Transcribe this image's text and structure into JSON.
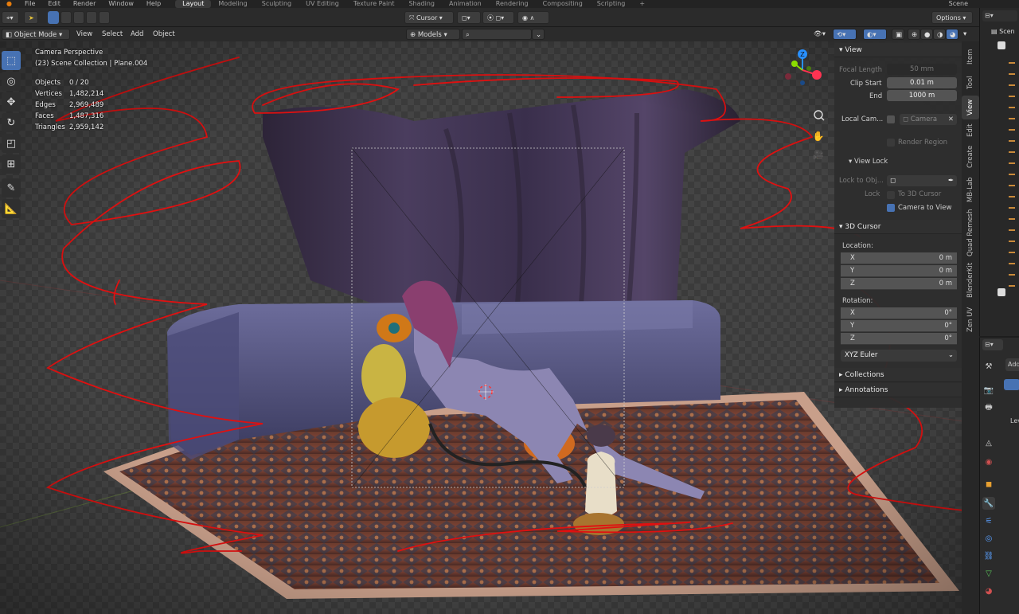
{
  "menu": [
    "File",
    "Edit",
    "Render",
    "Window",
    "Help"
  ],
  "workspaces": [
    {
      "label": "Layout",
      "active": true
    },
    {
      "label": "Modeling",
      "active": false
    },
    {
      "label": "Sculpting",
      "active": false
    },
    {
      "label": "UV Editing",
      "active": false
    },
    {
      "label": "Texture Paint",
      "active": false
    },
    {
      "label": "Shading",
      "active": false
    },
    {
      "label": "Animation",
      "active": false
    },
    {
      "label": "Rendering",
      "active": false
    },
    {
      "label": "Compositing",
      "active": false
    },
    {
      "label": "Scripting",
      "active": false
    }
  ],
  "add_workspace": "+",
  "scene_name": "Scene",
  "toolbar": {
    "pivot": "Cursor",
    "options": "Options",
    "models": "Models"
  },
  "header": {
    "mode": "Object Mode",
    "menus": [
      "View",
      "Select",
      "Add",
      "Object"
    ]
  },
  "overlay": {
    "view_name": "Camera Perspective",
    "collection": "(23) Scene Collection | Plane.004",
    "stats": [
      {
        "key": "Objects",
        "value": "0 / 20"
      },
      {
        "key": "Vertices",
        "value": "1,482,214"
      },
      {
        "key": "Edges",
        "value": "2,969,489"
      },
      {
        "key": "Faces",
        "value": "1,487,316"
      },
      {
        "key": "Triangles",
        "value": "2,959,142"
      }
    ]
  },
  "npanel": {
    "view": {
      "title": "View",
      "focal_label": "Focal Length",
      "focal_value": "50 mm",
      "clip_start_label": "Clip Start",
      "clip_start_value": "0.01 m",
      "end_label": "End",
      "end_value": "1000 m",
      "local_cam_label": "Local Cam...",
      "camera_value": "Camera",
      "render_region": "Render Region"
    },
    "view_lock": {
      "title": "View Lock",
      "lock_to_obj": "Lock to Obj...",
      "lock": "Lock",
      "to_3d_cursor": "To 3D Cursor",
      "camera_to_view": "Camera to View"
    },
    "cursor": {
      "title": "3D Cursor",
      "location_label": "Location:",
      "location": [
        {
          "axis": "X",
          "value": "0 m"
        },
        {
          "axis": "Y",
          "value": "0 m"
        },
        {
          "axis": "Z",
          "value": "0 m"
        }
      ],
      "rotation_label": "Rotation:",
      "rotation": [
        {
          "axis": "X",
          "value": "0°"
        },
        {
          "axis": "Y",
          "value": "0°"
        },
        {
          "axis": "Z",
          "value": "0°"
        }
      ],
      "rotation_mode": "XYZ Euler"
    },
    "collections": "Collections",
    "annotations": "Annotations"
  },
  "side_tabs": [
    "Item",
    "Tool",
    "View",
    "Edit",
    "Create",
    "MB-Lab",
    "Quad Remesh",
    "BlenderKit",
    "Zen UV"
  ],
  "active_side_tab": "View",
  "outliner": {
    "header": "Scen"
  },
  "properties": {
    "add": "Add",
    "item": "Lev"
  },
  "colors": {
    "accent": "#4772b3",
    "annotation": "#e01010",
    "axis_x": "#ff3352",
    "axis_y": "#8bdc00",
    "axis_z": "#2890ff"
  }
}
